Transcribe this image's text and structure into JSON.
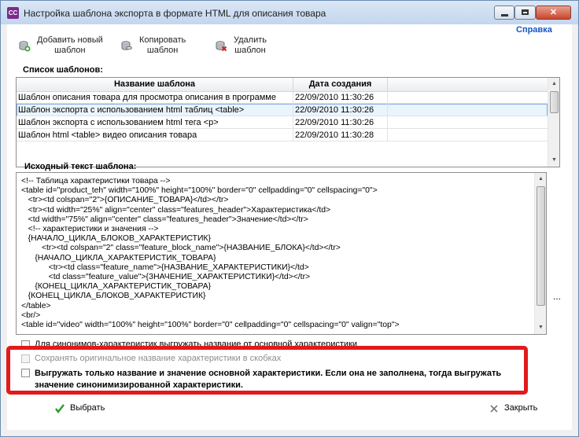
{
  "window": {
    "title": "Настройка шаблона экспорта в формате HTML для описания товара",
    "app_icon_text": "CC"
  },
  "help_label": "Справка",
  "toolbar": {
    "add": "Добавить новый\nшаблон",
    "copy": "Копировать\nшаблон",
    "delete": "Удалить\nшаблон"
  },
  "templates": {
    "label": "Список шаблонов:",
    "columns": [
      "Название шаблона",
      "Дата создания"
    ],
    "rows": [
      {
        "name": "Шаблон описания товара для просмотра описания в программе",
        "date": "22/09/2010 11:30:26"
      },
      {
        "name": "Шаблон экспорта с использованием html таблиц <table>",
        "date": "22/09/2010 11:30:26"
      },
      {
        "name": "Шаблон экспорта с использованием html тега <p>",
        "date": "22/09/2010 11:30:26"
      },
      {
        "name": "Шаблон html <table> видео описания товара",
        "date": "22/09/2010 11:30:28"
      }
    ],
    "selected_index": 1
  },
  "source": {
    "label": "Исходный текст шаблона:",
    "lines": [
      "<!-- Таблица характеристики товара -->",
      "<table id=\"product_teh\" width=\"100%\" height=\"100%\" border=\"0\" cellpadding=\"0\" cellspacing=\"0\">",
      "   <tr><td colspan=\"2\">{ОПИСАНИЕ_ТОВАРА}</td></tr>",
      "   <tr><td width=\"25%\" align=\"center\" class=\"features_header\">Характеристика</td>",
      "   <td width=\"75%\" align=\"center\" class=\"features_header\">Значение</td></tr>",
      "   <!-- характеристики и значения -->",
      "   {НАЧАЛО_ЦИКЛА_БЛОКОВ_ХАРАКТЕРИСТИК}",
      "         <tr><td colspan=\"2\" class=\"feature_block_name\">{НАЗВАНИЕ_БЛОКА}</td></tr>",
      "      {НАЧАЛО_ЦИКЛА_ХАРАКТЕРИСТИК_ТОВАРА}",
      "            <tr><td class=\"feature_name\">{НАЗВАНИЕ_ХАРАКТЕРИСТИКИ}</td>",
      "            <td class=\"feature_value\">{ЗНАЧЕНИЕ_ХАРАКТЕРИСТИКИ}</td></tr>",
      "      {КОНЕЦ_ЦИКЛА_ХАРАКТЕРИСТИК_ТОВАРА}",
      "   {КОНЕЦ_ЦИКЛА_БЛОКОВ_ХАРАКТЕРИСТИК}",
      "</table>",
      "<br/>",
      "<table id=\"video\" width=\"100%\" height=\"100%\" border=\"0\" cellpadding=\"0\" cellspacing=\"0\" valign=\"top\">"
    ]
  },
  "options": {
    "synonyms": "Для синонимов-характеристик выгружать название от основной характеристики",
    "keep_original": "Сохранять оригинальное название характеристики в скобках",
    "only_main": "Выгружать только название и значение основной характеристики. Если она не заполнена, тогда выгружать значение синонимизированной характеристики."
  },
  "ellipsis": "...",
  "buttons": {
    "select": "Выбрать",
    "close": "Закрыть"
  }
}
